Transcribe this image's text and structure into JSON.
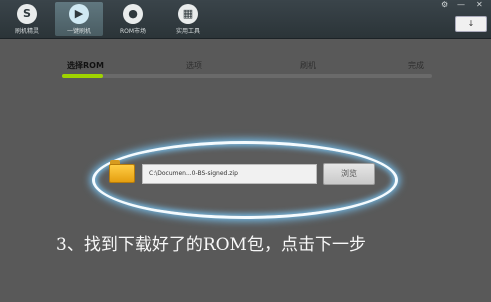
{
  "nav": {
    "items": [
      {
        "label": "刷机精灵",
        "icon": "S"
      },
      {
        "label": "一键刷机",
        "icon": "▶"
      },
      {
        "label": "ROM市场",
        "icon": "●"
      },
      {
        "label": "实用工具",
        "icon": "▦"
      }
    ]
  },
  "window": {
    "settings": "⚙",
    "minimize": "—",
    "close": "✕"
  },
  "update_button": "↓",
  "steps": [
    {
      "label": "选择ROM"
    },
    {
      "label": "选项"
    },
    {
      "label": "刷机"
    },
    {
      "label": "完成"
    }
  ],
  "progress_fraction": 0.11,
  "file": {
    "path": "C:\\Documen...0-BS-signed.zip",
    "browse_label": "浏览"
  },
  "caption": "3、找到下载好了的ROM包，点击下一步"
}
